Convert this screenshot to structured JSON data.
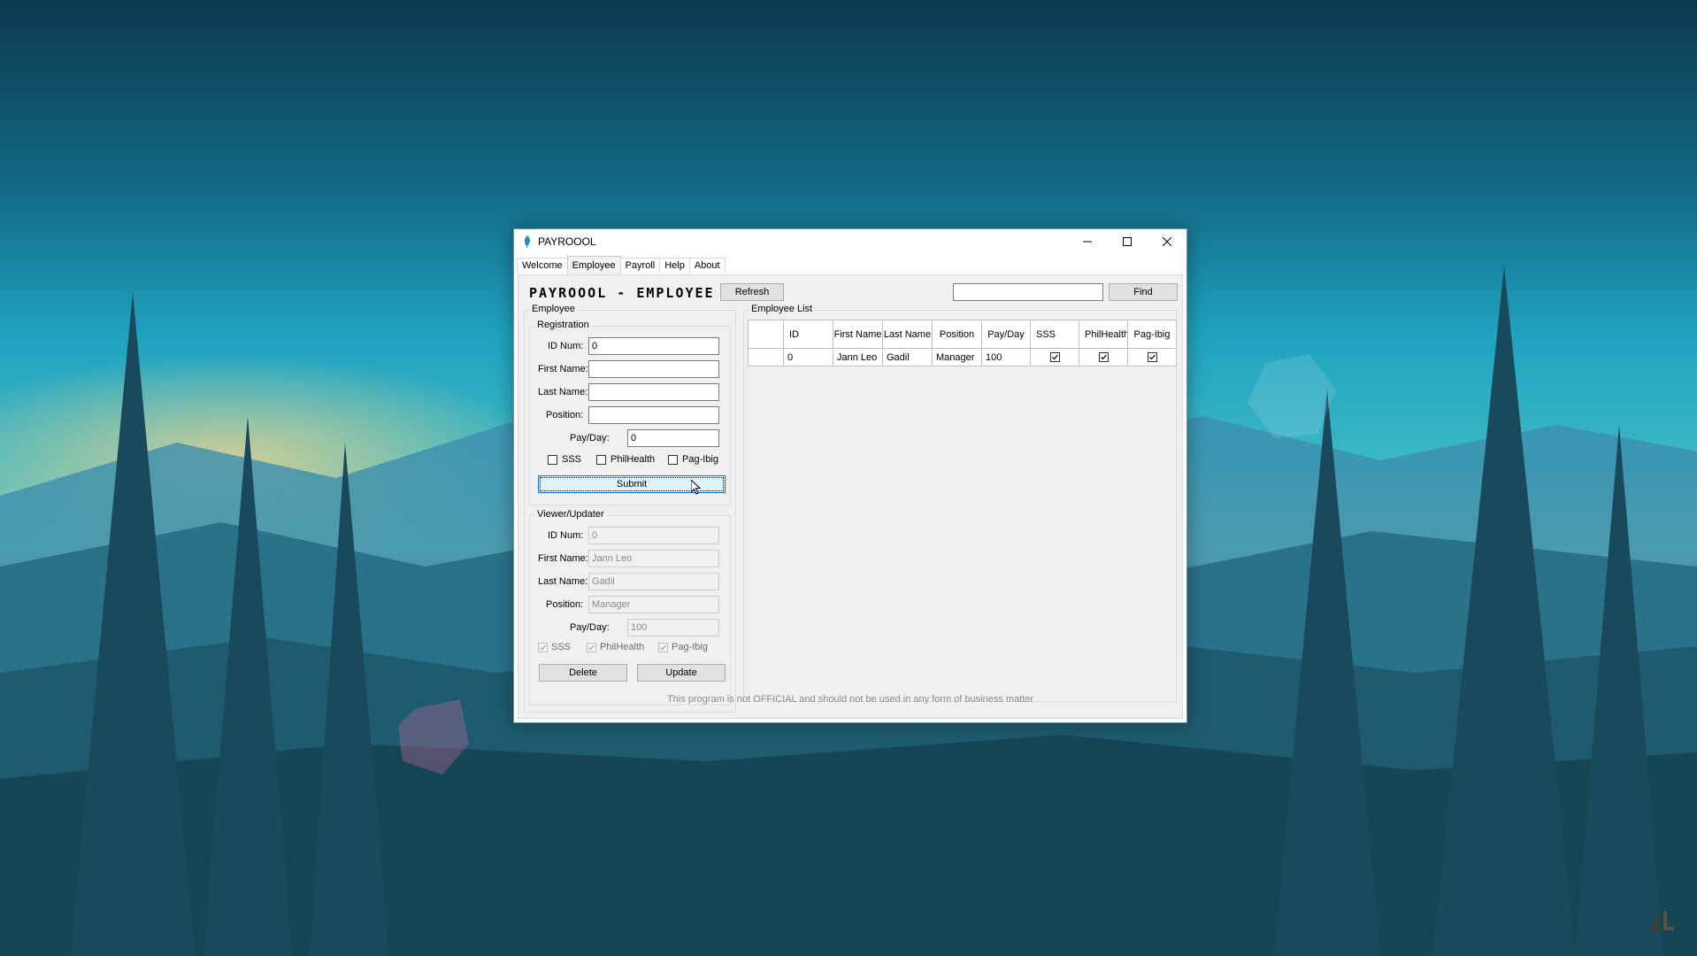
{
  "window": {
    "title": "PAYROOOL"
  },
  "tabs": [
    {
      "label": "Welcome"
    },
    {
      "label": "Employee"
    },
    {
      "label": "Payroll"
    },
    {
      "label": "Help"
    },
    {
      "label": "About"
    }
  ],
  "header": {
    "title": "PAYROOOL - EMPLOYEE",
    "refresh_label": "Refresh",
    "search_value": "",
    "find_label": "Find"
  },
  "employee_group": {
    "legend": "Employee",
    "registration": {
      "legend": "Registration",
      "id_label": "ID Num:",
      "id_value": "0",
      "first_label": "First Name:",
      "first_value": "",
      "last_label": "Last Name:",
      "last_value": "",
      "position_label": "Position:",
      "position_value": "",
      "pay_label": "Pay/Day:",
      "pay_value": "0",
      "sss_label": "SSS",
      "philhealth_label": "PhilHealth",
      "pagibig_label": "Pag-Ibig",
      "sss_checked": false,
      "philhealth_checked": false,
      "pagibig_checked": false,
      "submit_label": "Submit"
    },
    "viewer": {
      "legend": "Viewer/Updater",
      "id_label": "ID Num:",
      "id_value": "0",
      "first_label": "First Name:",
      "first_value": "Jann Leo",
      "last_label": "Last Name:",
      "last_value": "Gadil",
      "position_label": "Position:",
      "position_value": "Manager",
      "pay_label": "Pay/Day:",
      "pay_value": "100",
      "sss_label": "SSS",
      "philhealth_label": "PhilHealth",
      "pagibig_label": "Pag-Ibig",
      "sss_checked": true,
      "philhealth_checked": true,
      "pagibig_checked": true,
      "delete_label": "Delete",
      "update_label": "Update"
    }
  },
  "employee_list": {
    "legend": "Employee List",
    "columns": [
      "",
      "ID",
      "First Name",
      "Last Name",
      "Position",
      "Pay/Day",
      "SSS",
      "PhilHealth",
      "Pag-Ibig"
    ],
    "rows": [
      {
        "id": "0",
        "first": "Jann Leo",
        "last": "Gadil",
        "position": "Manager",
        "pay": "100",
        "sss": true,
        "philhealth": true,
        "pagibig": true
      }
    ]
  },
  "footer": {
    "note": "This program is not OFFICIAL and should not be used in any form of business matter"
  }
}
